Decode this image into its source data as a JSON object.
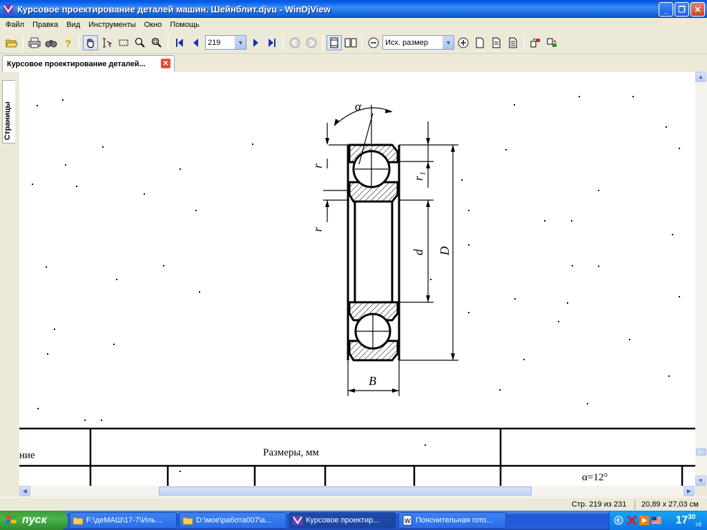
{
  "window": {
    "title": "Курсовое проектирование деталей машин. Шейнблит.djvu - WinDjView",
    "min_label": "_",
    "max_label": "❐",
    "close_label": "✕"
  },
  "menu": [
    "Файл",
    "Правка",
    "Вид",
    "Инструменты",
    "Окно",
    "Помощь"
  ],
  "toolbar": {
    "page_number": "219",
    "zoom": "Исх. размер"
  },
  "tab": {
    "label": "Курсовое проектирование деталей...",
    "close_label": "✕"
  },
  "sidebar": {
    "pages_tab": "Страницы"
  },
  "drawing": {
    "alpha_label": "α",
    "r_label": "r",
    "r1_label": "r₁",
    "d_label": "d",
    "D_label": "D",
    "B_label": "B"
  },
  "table": {
    "col_name_partial": "ние",
    "col_sizes": "Размеры, мм",
    "alpha_value": "α=12°"
  },
  "status": {
    "page_info": "Стр. 219 из 231",
    "page_size": "20,89 x 27,03 см"
  },
  "taskbar": {
    "start_label": "пуск",
    "items": [
      "F:\\деМАШ\\17-7\\Иль...",
      "D:\\мое\\работа007\\а...",
      "Курсовое проектир...",
      "Пояснительная гото..."
    ],
    "clock_hour": "17",
    "clock_min": "30",
    "clock_day": "сб"
  }
}
